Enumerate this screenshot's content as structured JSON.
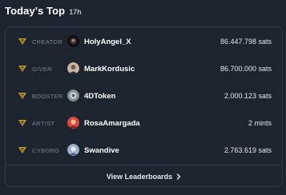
{
  "header": {
    "title": "Today's Top",
    "age": "17h"
  },
  "rows": [
    {
      "role": "CREATOR",
      "username": "HolyAngel_X",
      "amount": "86.447.798 sats",
      "avatar_icon": "avatar-dark-icon"
    },
    {
      "role": "GIVER",
      "username": "MarkKordusic",
      "amount": "86.700.000 sats",
      "avatar_icon": "avatar-person-icon"
    },
    {
      "role": "BOOSTER",
      "username": "4DToken",
      "amount": "2.000.123 sats",
      "avatar_icon": "avatar-gray-icon"
    },
    {
      "role": "ARTIST",
      "username": "RosaAmargada",
      "amount": "2 mints",
      "avatar_icon": "avatar-red-icon"
    },
    {
      "role": "CYBORG",
      "username": "Swandive",
      "amount": "2.763.619 sats",
      "avatar_icon": "avatar-blue-icon"
    }
  ],
  "footer": {
    "link_label": "View Leaderboards"
  },
  "colors": {
    "background": "#1c2430",
    "border": "#333d4a",
    "accent_gold": "#c8a02a",
    "role_text": "#7c8491"
  }
}
